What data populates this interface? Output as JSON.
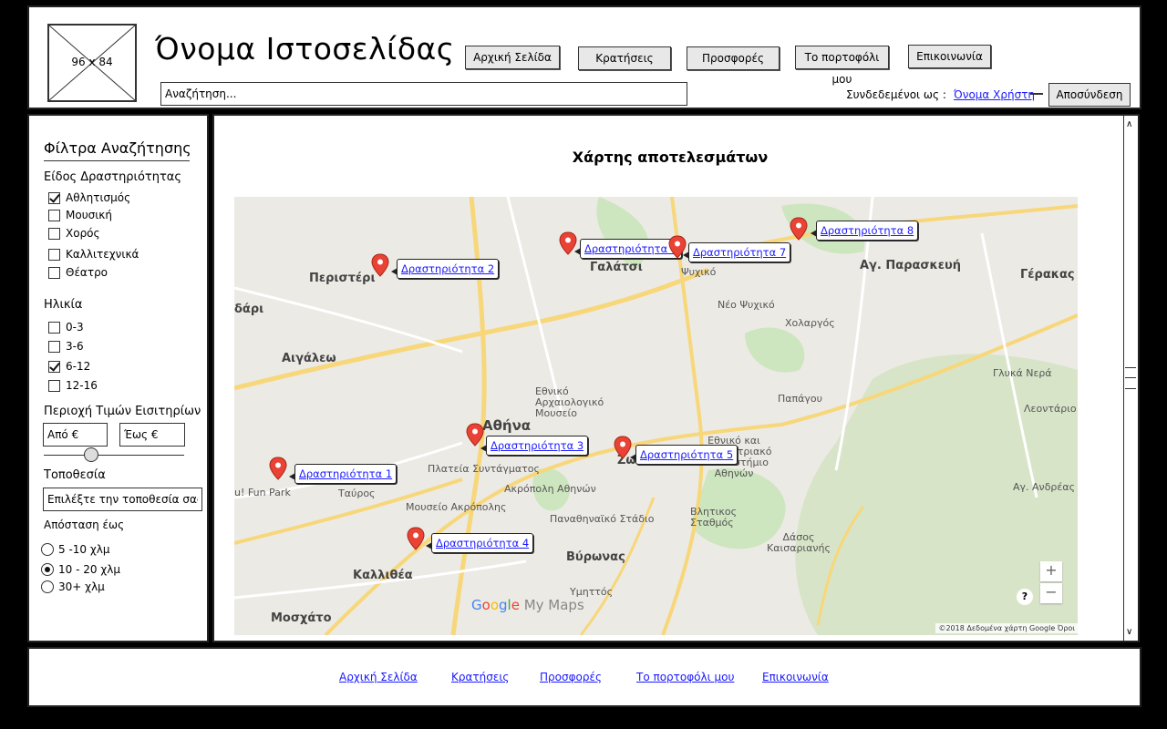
{
  "header": {
    "logo_label": "96 x 84",
    "site_title": "Όνομα Ιστοσελίδας",
    "nav": [
      "Αρχική Σελίδα",
      "Κρατήσεις",
      "Προσφορές",
      "Το πορτοφόλι μου",
      "Επικοινωνία"
    ],
    "search_placeholder": "Αναζήτηση...",
    "logged_in_label": "Συνδεδεμένοι ως :",
    "username": "Όνομα Χρήστη",
    "logout": "Αποσύνδεση"
  },
  "sidebar": {
    "title": "Φίλτρα Αναζήτησης",
    "activity_type": {
      "heading": "Είδος Δραστηριότητας",
      "options": [
        {
          "label": "Αθλητισμός",
          "checked": true
        },
        {
          "label": "Μουσική",
          "checked": false
        },
        {
          "label": "Χορός",
          "checked": false
        },
        {
          "label": "Καλλιτεχνικά",
          "checked": false
        },
        {
          "label": "Θέατρο",
          "checked": false
        }
      ]
    },
    "age": {
      "heading": "Ηλικία",
      "options": [
        {
          "label": "0-3",
          "checked": false
        },
        {
          "label": "3-6",
          "checked": false
        },
        {
          "label": "6-12",
          "checked": true
        },
        {
          "label": "12-16",
          "checked": false
        }
      ]
    },
    "price": {
      "heading": "Περιοχή Τιμών Εισιτηρίων",
      "from_placeholder": "Από €",
      "to_placeholder": "Έως €",
      "slider_value": 0.33
    },
    "location": {
      "heading": "Τοποθεσία",
      "placeholder": "Επιλέξτε την τοποθεσία σας... |"
    },
    "distance": {
      "heading": "Απόσταση έως",
      "options": [
        {
          "label": "5 -10 χλμ",
          "checked": false
        },
        {
          "label": "10 - 20 χλμ",
          "checked": true
        },
        {
          "label": "30+ χλμ",
          "checked": false
        }
      ]
    }
  },
  "main": {
    "map_title": "Χάρτης αποτελεσμάτων",
    "activities": [
      "Δραστηριότητα 1",
      "Δραστηριότητα 2",
      "Δραστηριότητα 3",
      "Δραστηριότητα 4",
      "Δραστηριότητα 5",
      "Δραστηριότητα 6",
      "Δραστηριότητα 7",
      "Δραστηριότητα 8"
    ],
    "places": {
      "peristeri": "Περιστέρι",
      "galatsi": "Γαλάτσι",
      "psychiko": "Ψυχικό",
      "neo_psychiko": "Νέο Ψυχικό",
      "ag_paraskevi": "Αγ. Παρασκευή",
      "gerakas": "Γέρακας",
      "cholargos": "Χολαργός",
      "aigaleo": "Αιγάλεω",
      "athina": "Αθήνα",
      "museum": "Εθνικό Αρχαιολογικό Μουσείο",
      "syntagma": "Πλατεία Συντάγματος",
      "acropolis": "Ακρόπολη Αθηνών",
      "acropolis_museum": "Μουσείο Ακρόπολης",
      "stadium": "Παναθηναϊκό Στάδιο",
      "university": "Εθνικό και Καποδιστριακό Πανεπιστήμιο Αθηνών",
      "vyronas": "Βύρωνας",
      "kallithea": "Καλλιθέα",
      "moschato": "Μοσχάτο",
      "ymittos": "Υμηττός",
      "papagou": "Παπάγου",
      "glyka_nera": "Γλυκά Νερά",
      "leontario": "Λεοντάριο",
      "ag_andreas": "Αγ. Ανδρέας",
      "forest": "Δάσος Καισαριανής",
      "vlitikos": "Βλητικος Σταθμός",
      "fun_park": "u! Fun Park",
      "tavros": "Ταύρος",
      "dari": "δάρι",
      "zo": "Ζω"
    },
    "google_logo": [
      "G",
      "o",
      "o",
      "g",
      "l",
      "e",
      " My Maps"
    ],
    "map_credit": "©2018 Δεδομένα χάρτη Google   Όροι",
    "zoom_in": "+",
    "zoom_out": "−",
    "help": "?"
  },
  "footer": {
    "links": [
      "Αρχική Σελίδα",
      "Κρατήσεις",
      "Προσφορές",
      "Το πορτοφόλι μου",
      "Επικοινωνία"
    ]
  },
  "colors": {
    "link": "#1a1aff",
    "pin": "#ea4335",
    "map_park": "#cde6bf",
    "map_road": "#f7d77a"
  }
}
